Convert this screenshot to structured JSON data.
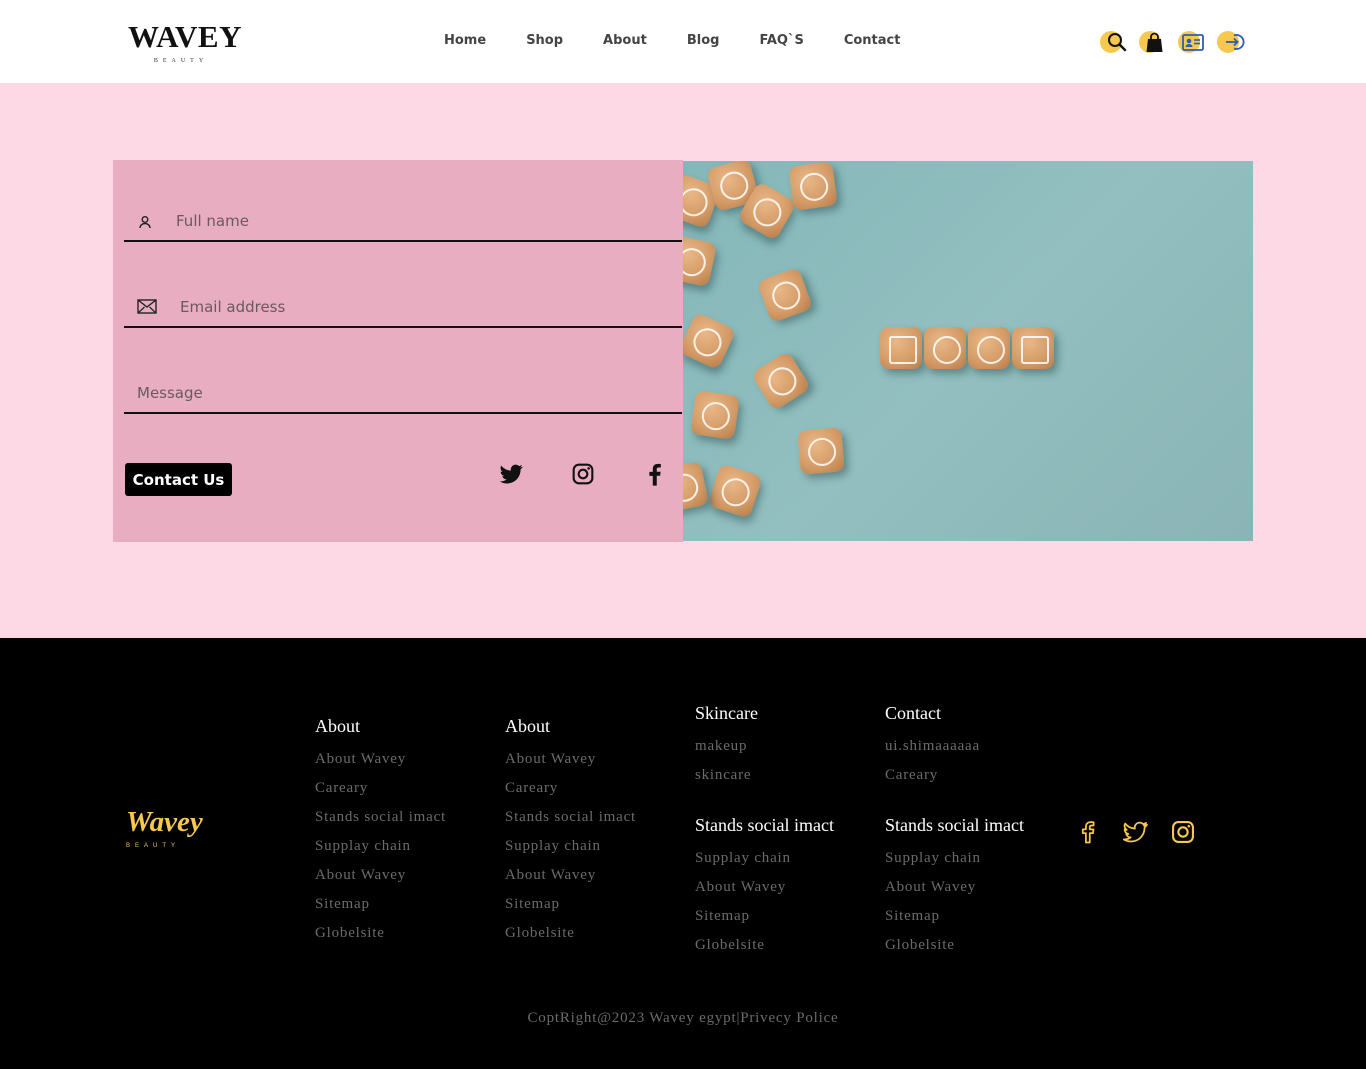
{
  "brand": {
    "name": "WAVEY",
    "tagline": "BEAUTY"
  },
  "nav": {
    "items": [
      "Home",
      "Shop",
      "About",
      "Blog",
      "FAQ`S",
      "Contact"
    ]
  },
  "header_icons": [
    "search-icon",
    "shopping-bag-icon",
    "profile-card-icon",
    "login-icon"
  ],
  "form": {
    "name_placeholder": "Full name",
    "email_placeholder": "Email address",
    "message_placeholder": "Message",
    "submit_label": "Contact Us"
  },
  "card_social": [
    "twitter-icon",
    "instagram-icon",
    "facebook-icon"
  ],
  "colors": {
    "accent": "#f6c84e",
    "pink_bg": "#fdd9e5",
    "card_bg": "#e8adc0",
    "photo_bg": "#8fbcbd"
  },
  "footer": {
    "logo": "Wavey",
    "tagline": "BEAUTY",
    "col1": {
      "title": "About",
      "links": [
        "About Wavey",
        "Careary",
        "Stands social imact",
        "Supplay chain",
        "About Wavey",
        "Sitemap",
        "Globelsite"
      ]
    },
    "col2": {
      "title": "About",
      "links": [
        "About Wavey",
        "Careary",
        "Stands social imact",
        "Supplay chain",
        "About Wavey",
        "Sitemap",
        "Globelsite"
      ]
    },
    "col3a": {
      "title": "Skincare",
      "links": [
        "makeup",
        "skincare"
      ]
    },
    "col3b": {
      "title": "Stands social imact",
      "links": [
        "Supplay chain",
        "About Wavey",
        "Sitemap",
        "Globelsite"
      ]
    },
    "col4a": {
      "title": "Contact",
      "links": [
        "ui.shimaaaaaa",
        "Careary"
      ]
    },
    "col4b": {
      "title": "Stands social imact",
      "links": [
        "Supplay chain",
        "About Wavey",
        "Sitemap",
        "Globelsite"
      ]
    },
    "social": [
      "facebook-icon",
      "twitter-icon",
      "instagram-icon"
    ],
    "copyright": "CoptRight@2023 Wavey egypt",
    "policy": "Privecy Police"
  }
}
